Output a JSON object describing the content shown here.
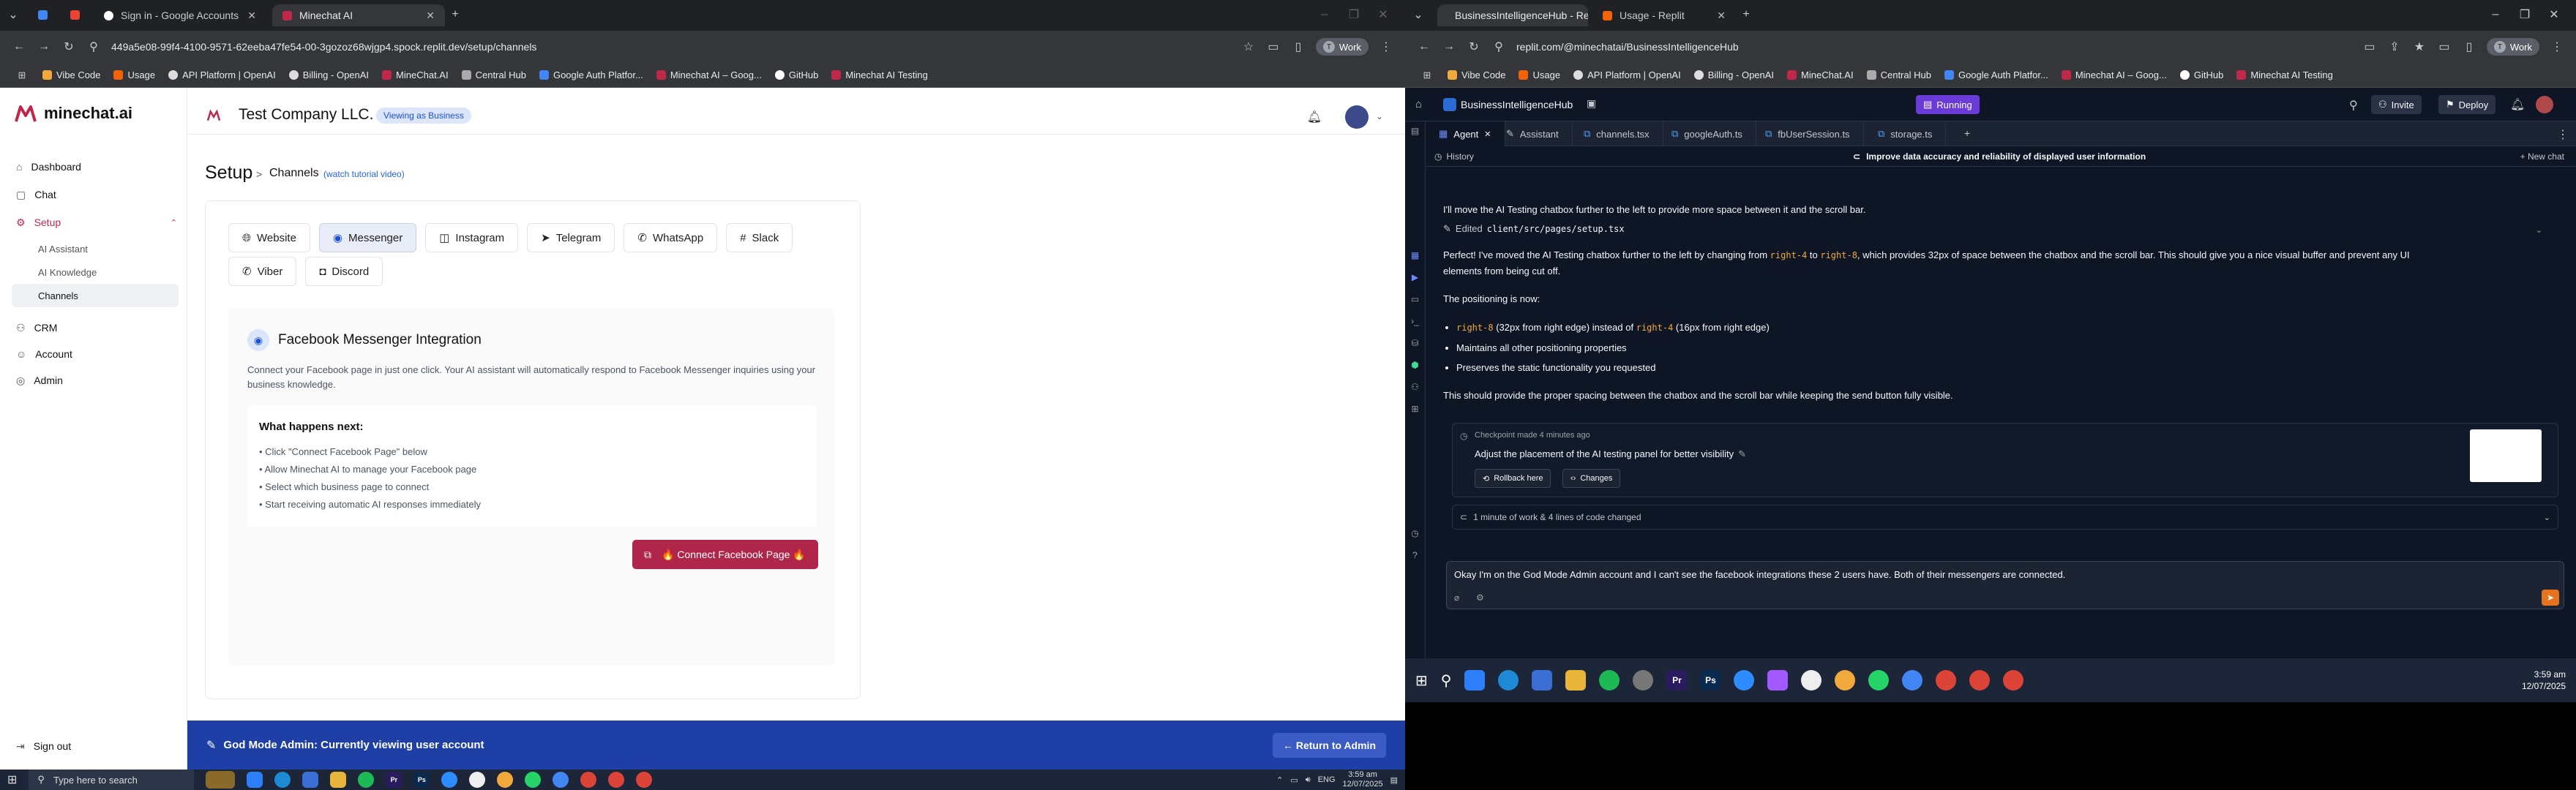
{
  "left_browser": {
    "tabs": [
      {
        "title": "Sign in - Google Accounts"
      },
      {
        "title": "Minechat AI"
      }
    ],
    "url": "449a5e08-99f4-4100-9571-62eeba47fe54-00-3gozoz68wjgp4.spock.replit.dev/setup/channels",
    "profile": "Work",
    "bookmarks": [
      "Vibe Code",
      "Usage",
      "API Platform | OpenAI",
      "Billing - OpenAI",
      "MineChat.AI",
      "Central Hub",
      "Google Auth Platfor...",
      "Minechat AI – Goog...",
      "GitHub",
      "Minechat AI Testing"
    ]
  },
  "app": {
    "logo": "minechat.ai",
    "company": "Test Company LLC.",
    "viewing_badge": "Viewing as Business",
    "sidebar": {
      "items": [
        "Dashboard",
        "Chat",
        "Setup",
        "CRM",
        "Account",
        "Admin"
      ],
      "setup_sub": [
        "AI Assistant",
        "AI Knowledge",
        "Channels"
      ],
      "sign_out": "Sign out"
    },
    "page_title": "Setup",
    "breadcrumb_sep": ">",
    "breadcrumb": "Channels",
    "tutorial": "(watch tutorial video)",
    "channels": [
      "Website",
      "Messenger",
      "Instagram",
      "Telegram",
      "WhatsApp",
      "Slack",
      "Viber",
      "Discord"
    ],
    "selected_channel": "Messenger",
    "integration": {
      "title": "Facebook Messenger Integration",
      "description": "Connect your Facebook page in just one click. Your AI assistant will automatically respond to Facebook Messenger inquiries using your business knowledge.",
      "next_title": "What happens next:",
      "steps": [
        "• Click \"Connect Facebook Page\" below",
        "• Allow Minechat AI to manage your Facebook page",
        "• Select which business page to connect",
        "• Start receiving automatic AI responses immediately"
      ],
      "button": "🔥 Connect Facebook Page 🔥"
    },
    "god_mode": {
      "text": "God Mode Admin: Currently viewing user account",
      "return_button": "← Return to Admin"
    }
  },
  "left_taskbar": {
    "search_placeholder": "Type here to search",
    "time": "3:59 am",
    "date": "12/07/2025",
    "lang": "ENG"
  },
  "right_browser": {
    "tabs": [
      {
        "title": "BusinessIntelligenceHub - Repli"
      },
      {
        "title": "Usage - Replit"
      }
    ],
    "url": "replit.com/@minechatai/BusinessIntelligenceHub",
    "profile": "Work",
    "bookmarks": [
      "Vibe Code",
      "Usage",
      "API Platform | OpenAI",
      "Billing - OpenAI",
      "MineChat.AI",
      "Central Hub",
      "Google Auth Platfor...",
      "Minechat AI – Goog...",
      "GitHub",
      "Minechat AI Testing"
    ]
  },
  "replit": {
    "project": "BusinessIntelligenceHub",
    "status": "Running",
    "invite": "Invite",
    "deploy": "Deploy",
    "tabs": [
      "Agent",
      "Assistant",
      "channels.tsx",
      "googleAuth.ts",
      "fbUserSession.ts",
      "storage.ts"
    ],
    "history": "History",
    "thread_title": "Improve data accuracy and reliability of displayed user information",
    "new_chat": "+ New chat",
    "messages": {
      "m1": "I'll move the AI Testing chatbox further to the left to provide more space between it and the scroll bar.",
      "edited_label": "Edited",
      "edited_file": "client/src/pages/setup.tsx",
      "m2_a": "Perfect! I've moved the AI Testing chatbox further to the left by changing from",
      "m2_code1": "right-4",
      "m2_to": "to",
      "m2_code2": "right-8",
      "m2_b": ", which provides 32px of space between the chatbox and the scroll bar. This should give you a nice visual buffer and prevent any UI",
      "m2_c": "elements from being cut off.",
      "positioning": "The positioning is now:",
      "b1_code": "right-8",
      "b1_text": "(32px from right edge) instead of",
      "b1_code2": "right-4",
      "b1_text2": "(16px from right edge)",
      "b2": "Maintains all other positioning properties",
      "b3": "Preserves the static functionality you requested",
      "m3": "This should provide the proper spacing between the chatbox and the scroll bar while keeping the send button fully visible."
    },
    "checkpoint": {
      "label": "Checkpoint made 4 minutes ago",
      "title": "Adjust the placement of the AI testing panel for better visibility",
      "rollback": "Rollback here",
      "changes": "Changes"
    },
    "work_summary": "1 minute of work & 4 lines of code changed",
    "input_text": "Okay I'm on the God Mode Admin account and I can't see the facebook integrations these 2 users have. Both of their messengers are connected."
  },
  "right_taskbar": {
    "time": "3:59 am",
    "date": "12/07/2025"
  },
  "colors": {
    "brand": "#c0284a",
    "god_bar": "#1d3fa6",
    "replit_bg": "#0e1525",
    "running": "#6a3bd6"
  }
}
